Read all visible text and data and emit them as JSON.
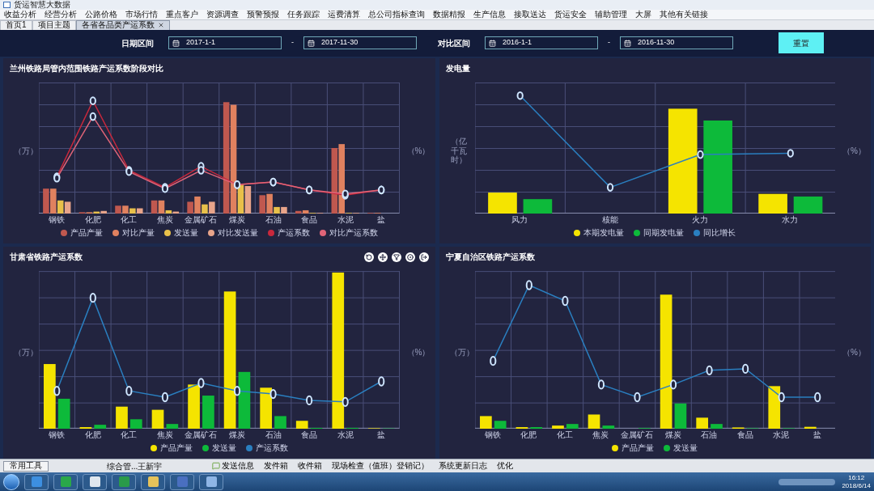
{
  "window": {
    "title": "货运智慧大数据"
  },
  "menu": [
    {
      "label": "收益分析"
    },
    {
      "label": "经营分析"
    },
    {
      "label": "公路价格"
    },
    {
      "label": "市场行情"
    },
    {
      "label": "重点客户"
    },
    {
      "label": "资源调查"
    },
    {
      "label": "预警预报"
    },
    {
      "label": "任务跟踪"
    },
    {
      "label": "运费清算"
    },
    {
      "label": "总公司指标查询"
    },
    {
      "label": "数据精报"
    },
    {
      "label": "生产信息"
    },
    {
      "label": "接取送达"
    },
    {
      "label": "货运安全"
    },
    {
      "label": "辅助管理"
    },
    {
      "label": "大屏"
    },
    {
      "label": "其他有关链接"
    }
  ],
  "tabs": [
    {
      "label": "首页1",
      "selected": false,
      "closable": false
    },
    {
      "label": "项目主题",
      "selected": false,
      "closable": false
    },
    {
      "label": "各省各品类产运系数",
      "selected": true,
      "closable": true
    }
  ],
  "filters": [
    {
      "label": "日期区间",
      "start": "2017-1-1",
      "separator": "-",
      "end": "2017-11-30"
    },
    {
      "label": "对比区间",
      "start": "2016-1-1",
      "separator": "-",
      "end": "2016-11-30"
    }
  ],
  "reset_button": "重置",
  "panels": [
    {
      "title": "兰州铁路局管内范围铁路产运系数阶段对比",
      "y_label": "（万）",
      "y2_label": "（%）",
      "toolbar": false,
      "categories": [
        "钢铁",
        "化肥",
        "化工",
        "焦炭",
        "金属矿石",
        "煤炭",
        "石油",
        "食品",
        "水泥",
        "盐"
      ],
      "legend": [
        {
          "label": "产品产量",
          "color": "#c0584f"
        },
        {
          "label": "对比产量",
          "color": "#e0815f"
        },
        {
          "label": "发送量",
          "color": "#e8c04a"
        },
        {
          "label": "对比发送量",
          "color": "#e8a48a"
        },
        {
          "label": "产运系数",
          "color": "#c8283c"
        },
        {
          "label": "对比产运系数",
          "color": "#e06478"
        }
      ]
    },
    {
      "title": "发电量",
      "y_label": "（亿千瓦时）",
      "y2_label": "（%）",
      "toolbar": false,
      "categories": [
        "风力",
        "核能",
        "火力",
        "水力"
      ],
      "legend": [
        {
          "label": "本期发电量",
          "color": "#f5e400"
        },
        {
          "label": "同期发电量",
          "color": "#0dba3a"
        },
        {
          "label": "同比增长",
          "color": "#2a7fc0"
        }
      ]
    },
    {
      "title": "甘肃省铁路产运系数",
      "y_label": "（万）",
      "y2_label": "（%）",
      "toolbar": true,
      "categories": [
        "钢铁",
        "化肥",
        "化工",
        "焦炭",
        "金属矿石",
        "煤炭",
        "石油",
        "食品",
        "水泥",
        "盐"
      ],
      "legend": [
        {
          "label": "产品产量",
          "color": "#f5e400"
        },
        {
          "label": "发送量",
          "color": "#0dba3a"
        },
        {
          "label": "产运系数",
          "color": "#2a7fc0"
        }
      ]
    },
    {
      "title": "宁夏自治区铁路产运系数",
      "y_label": "（万）",
      "y2_label": "（%）",
      "toolbar": false,
      "categories": [
        "钢铁",
        "化肥",
        "化工",
        "焦炭",
        "金属矿石",
        "煤炭",
        "石油",
        "食品",
        "水泥",
        "盐"
      ],
      "legend": [
        {
          "label": "产品产量",
          "color": "#f5e400"
        },
        {
          "label": "发送量",
          "color": "#0dba3a"
        }
      ]
    }
  ],
  "status_bar": {
    "tools_button": "常用工具",
    "user": "综合管...王新宇",
    "links": [
      {
        "label": "发送信息",
        "icon": true
      },
      {
        "label": "发件箱",
        "icon": false
      },
      {
        "label": "收件箱",
        "icon": false
      },
      {
        "label": "现场检查（值班）登销记）",
        "icon": false
      },
      {
        "label": "系统更新日志",
        "icon": false
      },
      {
        "label": "优化",
        "icon": false
      }
    ]
  },
  "taskbar": {
    "time": "16:12",
    "date": "2018/6/14"
  }
}
